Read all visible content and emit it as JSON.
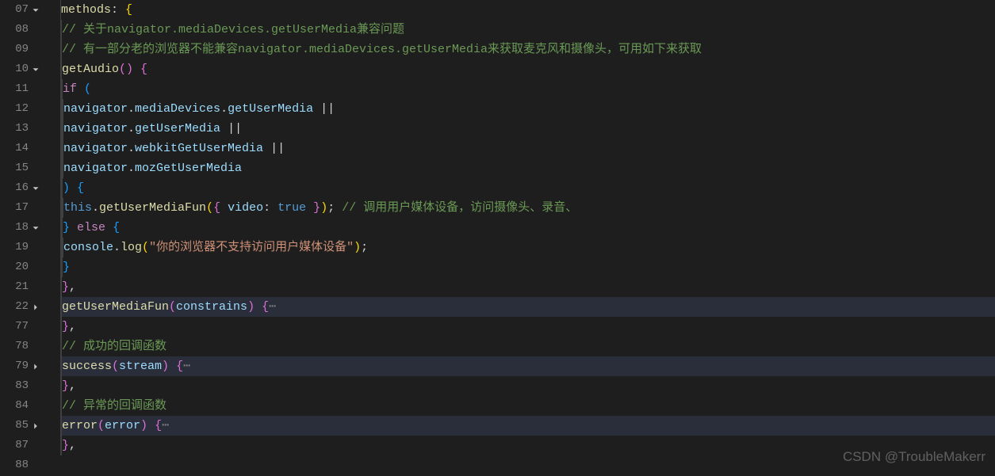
{
  "watermark": "CSDN @TroubleMakerr",
  "gutter": [
    {
      "ln": "07",
      "fold": "down"
    },
    {
      "ln": "08",
      "fold": ""
    },
    {
      "ln": "09",
      "fold": ""
    },
    {
      "ln": "10",
      "fold": "down"
    },
    {
      "ln": "11",
      "fold": ""
    },
    {
      "ln": "12",
      "fold": ""
    },
    {
      "ln": "13",
      "fold": ""
    },
    {
      "ln": "14",
      "fold": ""
    },
    {
      "ln": "15",
      "fold": ""
    },
    {
      "ln": "16",
      "fold": "down"
    },
    {
      "ln": "17",
      "fold": ""
    },
    {
      "ln": "18",
      "fold": "down"
    },
    {
      "ln": "19",
      "fold": ""
    },
    {
      "ln": "20",
      "fold": ""
    },
    {
      "ln": "21",
      "fold": ""
    },
    {
      "ln": "22",
      "fold": "right"
    },
    {
      "ln": "77",
      "fold": ""
    },
    {
      "ln": "78",
      "fold": ""
    },
    {
      "ln": "79",
      "fold": "right"
    },
    {
      "ln": "83",
      "fold": ""
    },
    {
      "ln": "84",
      "fold": ""
    },
    {
      "ln": "85",
      "fold": "right"
    },
    {
      "ln": "87",
      "fold": ""
    },
    {
      "ln": "88",
      "fold": ""
    }
  ],
  "code": [
    {
      "indent": 1,
      "hl": false,
      "tokens": [
        {
          "c": "c-fn",
          "t": "methods"
        },
        {
          "c": "c-punc",
          "t": ": "
        },
        {
          "c": "c-brace-y",
          "t": "{"
        }
      ]
    },
    {
      "indent": 2,
      "hl": false,
      "tokens": [
        {
          "c": "c-comment",
          "t": "// 关于navigator.mediaDevices.getUserMedia兼容问题"
        }
      ]
    },
    {
      "indent": 2,
      "hl": false,
      "tokens": [
        {
          "c": "c-comment",
          "t": "// 有一部分老的浏览器不能兼容navigator.mediaDevices.getUserMedia来获取麦克风和摄像头，可用如下来获取"
        }
      ]
    },
    {
      "indent": 2,
      "hl": false,
      "tokens": [
        {
          "c": "c-fn",
          "t": "getAudio"
        },
        {
          "c": "c-brace-p",
          "t": "()"
        },
        {
          "c": "c-punc",
          "t": " "
        },
        {
          "c": "c-brace-p",
          "t": "{"
        }
      ]
    },
    {
      "indent": 3,
      "hl": false,
      "tokens": [
        {
          "c": "c-key",
          "t": "if"
        },
        {
          "c": "c-punc",
          "t": " "
        },
        {
          "c": "c-brace-b",
          "t": "("
        }
      ]
    },
    {
      "indent": 4,
      "hl": false,
      "tokens": [
        {
          "c": "c-var",
          "t": "navigator"
        },
        {
          "c": "c-punc",
          "t": "."
        },
        {
          "c": "c-var",
          "t": "mediaDevices"
        },
        {
          "c": "c-punc",
          "t": "."
        },
        {
          "c": "c-var",
          "t": "getUserMedia"
        },
        {
          "c": "c-punc",
          "t": " || "
        }
      ]
    },
    {
      "indent": 4,
      "hl": false,
      "tokens": [
        {
          "c": "c-var",
          "t": "navigator"
        },
        {
          "c": "c-punc",
          "t": "."
        },
        {
          "c": "c-var",
          "t": "getUserMedia"
        },
        {
          "c": "c-punc",
          "t": " || "
        }
      ]
    },
    {
      "indent": 4,
      "hl": false,
      "tokens": [
        {
          "c": "c-var",
          "t": "navigator"
        },
        {
          "c": "c-punc",
          "t": "."
        },
        {
          "c": "c-var",
          "t": "webkitGetUserMedia"
        },
        {
          "c": "c-punc",
          "t": " || "
        }
      ]
    },
    {
      "indent": 4,
      "hl": false,
      "tokens": [
        {
          "c": "c-var",
          "t": "navigator"
        },
        {
          "c": "c-punc",
          "t": "."
        },
        {
          "c": "c-var",
          "t": "mozGetUserMedia"
        }
      ]
    },
    {
      "indent": 3,
      "hl": false,
      "tokens": [
        {
          "c": "c-brace-b",
          "t": ")"
        },
        {
          "c": "c-punc",
          "t": " "
        },
        {
          "c": "c-brace-b",
          "t": "{"
        }
      ]
    },
    {
      "indent": 4,
      "hl": false,
      "tokens": [
        {
          "c": "c-this",
          "t": "this"
        },
        {
          "c": "c-punc",
          "t": "."
        },
        {
          "c": "c-fn",
          "t": "getUserMediaFun"
        },
        {
          "c": "c-brace-y",
          "t": "("
        },
        {
          "c": "c-brace-p",
          "t": "{"
        },
        {
          "c": "c-punc",
          "t": " "
        },
        {
          "c": "c-var",
          "t": "video"
        },
        {
          "c": "c-punc",
          "t": ": "
        },
        {
          "c": "c-bool",
          "t": "true"
        },
        {
          "c": "c-punc",
          "t": " "
        },
        {
          "c": "c-brace-p",
          "t": "}"
        },
        {
          "c": "c-brace-y",
          "t": ")"
        },
        {
          "c": "c-punc",
          "t": "; "
        },
        {
          "c": "c-comment",
          "t": "// 调用用户媒体设备，访问摄像头、录音、"
        }
      ]
    },
    {
      "indent": 3,
      "hl": false,
      "tokens": [
        {
          "c": "c-brace-b",
          "t": "}"
        },
        {
          "c": "c-punc",
          "t": " "
        },
        {
          "c": "c-key",
          "t": "else"
        },
        {
          "c": "c-punc",
          "t": " "
        },
        {
          "c": "c-brace-b",
          "t": "{"
        }
      ]
    },
    {
      "indent": 4,
      "hl": false,
      "tokens": [
        {
          "c": "c-var",
          "t": "console"
        },
        {
          "c": "c-punc",
          "t": "."
        },
        {
          "c": "c-fn",
          "t": "log"
        },
        {
          "c": "c-brace-y",
          "t": "("
        },
        {
          "c": "c-str",
          "t": "\"你的浏览器不支持访问用户媒体设备\""
        },
        {
          "c": "c-brace-y",
          "t": ")"
        },
        {
          "c": "c-punc",
          "t": ";"
        }
      ]
    },
    {
      "indent": 3,
      "hl": false,
      "tokens": [
        {
          "c": "c-brace-b",
          "t": "}"
        }
      ]
    },
    {
      "indent": 2,
      "hl": false,
      "tokens": [
        {
          "c": "c-brace-p",
          "t": "}"
        },
        {
          "c": "c-punc",
          "t": ","
        }
      ]
    },
    {
      "indent": 2,
      "hl": true,
      "tokens": [
        {
          "c": "c-fn",
          "t": "getUserMediaFun"
        },
        {
          "c": "c-brace-p",
          "t": "("
        },
        {
          "c": "c-var",
          "t": "constrains"
        },
        {
          "c": "c-brace-p",
          "t": ")"
        },
        {
          "c": "c-punc",
          "t": " "
        },
        {
          "c": "c-brace-p",
          "t": "{"
        },
        {
          "c": "c-gray",
          "t": "⋯"
        }
      ]
    },
    {
      "indent": 2,
      "hl": false,
      "tokens": [
        {
          "c": "c-brace-p",
          "t": "}"
        },
        {
          "c": "c-punc",
          "t": ","
        }
      ]
    },
    {
      "indent": 2,
      "hl": false,
      "tokens": [
        {
          "c": "c-comment",
          "t": "// 成功的回调函数"
        }
      ]
    },
    {
      "indent": 2,
      "hl": true,
      "tokens": [
        {
          "c": "c-fn",
          "t": "success"
        },
        {
          "c": "c-brace-p",
          "t": "("
        },
        {
          "c": "c-var",
          "t": "stream"
        },
        {
          "c": "c-brace-p",
          "t": ")"
        },
        {
          "c": "c-punc",
          "t": " "
        },
        {
          "c": "c-brace-p",
          "t": "{"
        },
        {
          "c": "c-gray",
          "t": "⋯"
        }
      ]
    },
    {
      "indent": 2,
      "hl": false,
      "tokens": [
        {
          "c": "c-brace-p",
          "t": "}"
        },
        {
          "c": "c-punc",
          "t": ","
        }
      ]
    },
    {
      "indent": 2,
      "hl": false,
      "tokens": [
        {
          "c": "c-comment",
          "t": "// 异常的回调函数"
        }
      ]
    },
    {
      "indent": 2,
      "hl": true,
      "tokens": [
        {
          "c": "c-fn",
          "t": "error"
        },
        {
          "c": "c-brace-p",
          "t": "("
        },
        {
          "c": "c-var",
          "t": "error"
        },
        {
          "c": "c-brace-p",
          "t": ")"
        },
        {
          "c": "c-punc",
          "t": " "
        },
        {
          "c": "c-brace-p",
          "t": "{"
        },
        {
          "c": "c-gray",
          "t": "⋯"
        }
      ]
    },
    {
      "indent": 2,
      "hl": false,
      "tokens": [
        {
          "c": "c-brace-p",
          "t": "}"
        },
        {
          "c": "c-punc",
          "t": ","
        }
      ]
    },
    {
      "indent": 0,
      "hl": false,
      "tokens": []
    }
  ]
}
